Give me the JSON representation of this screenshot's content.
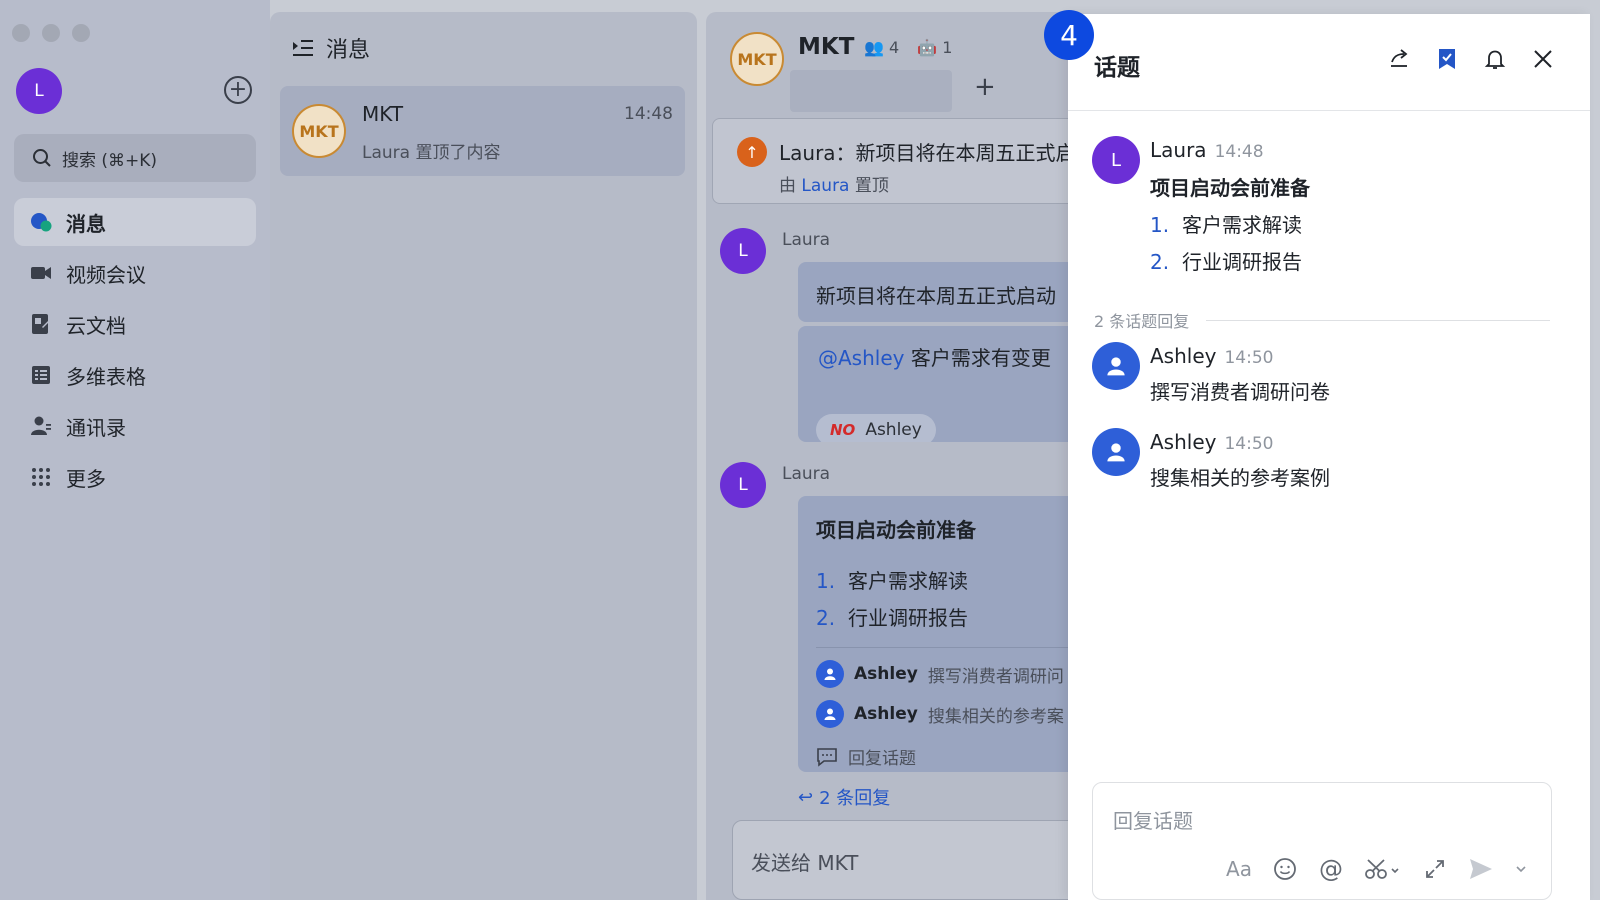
{
  "sidebar": {
    "avatar_letter": "L",
    "search_label": "搜索 (⌘+K)",
    "items": [
      {
        "label": "消息"
      },
      {
        "label": "视频会议"
      },
      {
        "label": "云文档"
      },
      {
        "label": "多维表格"
      },
      {
        "label": "通讯录"
      },
      {
        "label": "更多"
      }
    ]
  },
  "chat_list": {
    "title": "消息",
    "items": [
      {
        "avatar": "MKT",
        "name": "MKT",
        "time": "14:48",
        "preview": "Laura 置顶了内容"
      }
    ]
  },
  "chat": {
    "avatar": "MKT",
    "title": "MKT",
    "member_count": "4",
    "bot_count": "1",
    "plus": "+",
    "pin": {
      "text": "Laura：新项目将在本周五正式启",
      "by_prefix": "由",
      "by_name": "Laura",
      "by_suffix": "置顶"
    },
    "messages": [
      {
        "avatar": "L",
        "sender": "Laura",
        "line1": "新项目将在本周五正式启动",
        "mention": "@Ashley",
        "line2": "客户需求有变更",
        "ack_badge": "NO",
        "ack_name": "Ashley"
      },
      {
        "avatar": "L",
        "sender": "Laura",
        "title": "项目启动会前准备",
        "list": [
          {
            "num": "1.",
            "text": "客户需求解读"
          },
          {
            "num": "2.",
            "text": "行业调研报告"
          }
        ],
        "thread": [
          {
            "name": "Ashley",
            "text": "撰写消费者调研问"
          },
          {
            "name": "Ashley",
            "text": "搜集相关的参考案"
          }
        ],
        "reply_thread": "回复话题"
      }
    ],
    "replies_link": "2 条回复",
    "composer_placeholder": "发送给 MKT"
  },
  "panel": {
    "step": "4",
    "title": "话题",
    "root": {
      "avatar": "L",
      "name": "Laura",
      "time": "14:48",
      "title": "项目启动会前准备",
      "list": [
        {
          "num": "1.",
          "text": "客户需求解读"
        },
        {
          "num": "2.",
          "text": "行业调研报告"
        }
      ]
    },
    "reply_count": "2 条话题回复",
    "replies": [
      {
        "name": "Ashley",
        "time": "14:50",
        "text": "撰写消费者调研问卷"
      },
      {
        "name": "Ashley",
        "time": "14:50",
        "text": "搜集相关的参考案例"
      }
    ],
    "input_placeholder": "回复话题",
    "accent": "#0d49e0"
  }
}
